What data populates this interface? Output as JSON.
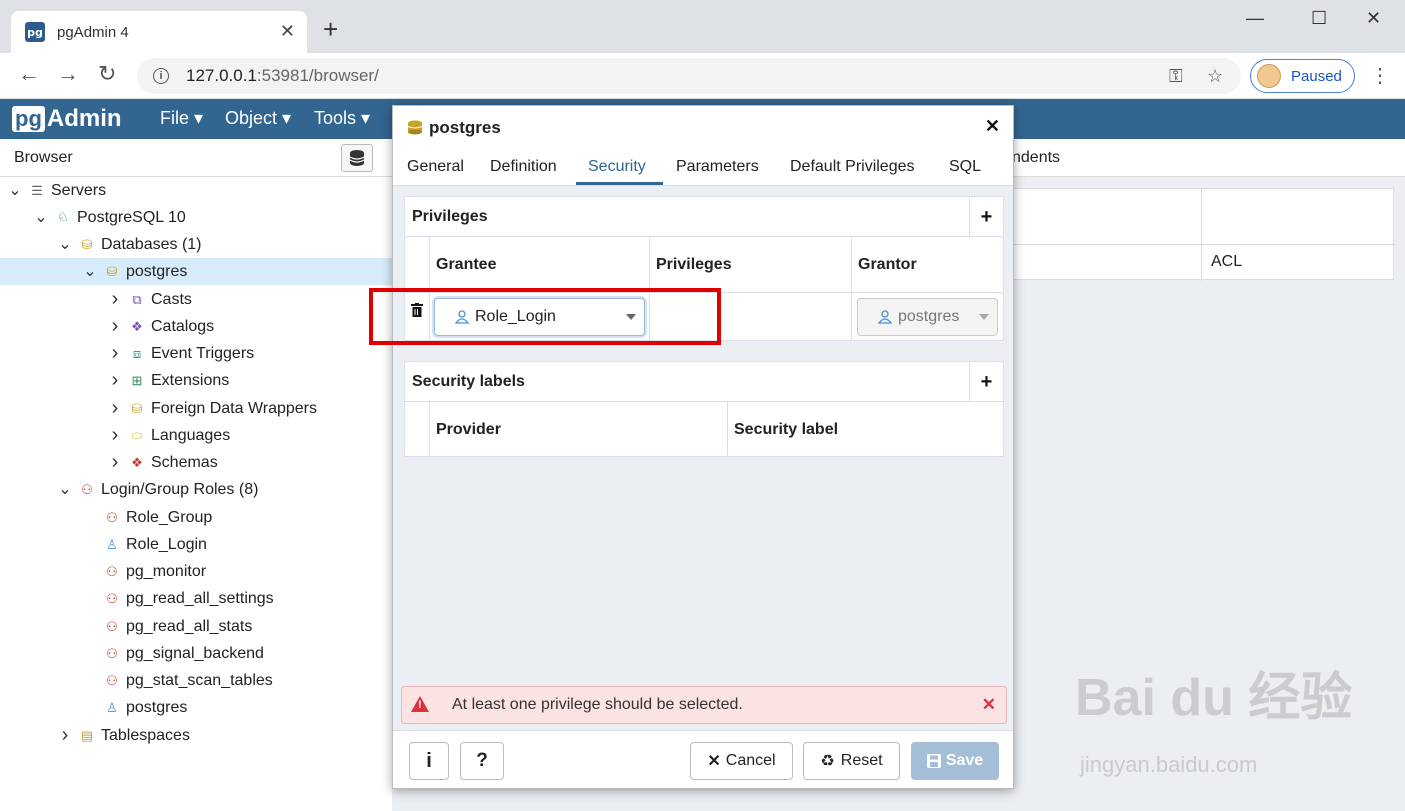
{
  "browser": {
    "tab_title": "pgAdmin 4",
    "favicon_text": "pg",
    "new_tab": "+",
    "url_host": "127.0.0.1",
    "url_rest": ":53981/browser/",
    "profile_label": "Paused"
  },
  "app": {
    "logo_pg": "pg",
    "logo_rest": "Admin",
    "menus": [
      "File ▾",
      "Object ▾",
      "Tools ▾"
    ]
  },
  "browser_panel": {
    "title": "Browser",
    "tree": [
      {
        "label": "Servers",
        "icon": "servers-icon",
        "color": "#666666"
      },
      {
        "label": "PostgreSQL 10",
        "icon": "postgresql-icon",
        "color": "#336791"
      },
      {
        "label": "Databases (1)",
        "icon": "databases-icon",
        "color": "#c9a227"
      },
      {
        "label": "postgres",
        "icon": "database-icon",
        "color": "#c9a227"
      },
      {
        "label": "Casts",
        "icon": "casts-icon",
        "color": "#7a4fb8"
      },
      {
        "label": "Catalogs",
        "icon": "catalogs-icon",
        "color": "#7a4fb8"
      },
      {
        "label": "Event Triggers",
        "icon": "event-triggers-icon",
        "color": "#2aa198"
      },
      {
        "label": "Extensions",
        "icon": "extensions-icon",
        "color": "#2e8b57"
      },
      {
        "label": "Foreign Data Wrappers",
        "icon": "fdw-icon",
        "color": "#c9a227"
      },
      {
        "label": "Languages",
        "icon": "languages-icon",
        "color": "#d4c21a"
      },
      {
        "label": "Schemas",
        "icon": "schemas-icon",
        "color": "#c0392b"
      },
      {
        "label": "Login/Group Roles (8)",
        "icon": "roles-icon",
        "color": "#c0392b"
      },
      {
        "label": "Role_Group",
        "icon": "group-role-icon",
        "color": "#c0392b"
      },
      {
        "label": "Role_Login",
        "icon": "login-role-icon",
        "color": "#4a90d9"
      },
      {
        "label": "pg_monitor",
        "icon": "group-role-icon",
        "color": "#c0392b"
      },
      {
        "label": "pg_read_all_settings",
        "icon": "group-role-icon",
        "color": "#c0392b"
      },
      {
        "label": "pg_read_all_stats",
        "icon": "group-role-icon",
        "color": "#c0392b"
      },
      {
        "label": "pg_signal_backend",
        "icon": "group-role-icon",
        "color": "#c0392b"
      },
      {
        "label": "pg_stat_scan_tables",
        "icon": "group-role-icon",
        "color": "#c0392b"
      },
      {
        "label": "postgres",
        "icon": "login-role-icon",
        "color": "#4a90d9"
      },
      {
        "label": "Tablespaces",
        "icon": "tablespaces-icon",
        "color": "#c9a227"
      }
    ]
  },
  "background": {
    "tab_label": "ndents",
    "acl_label": "ACL"
  },
  "dialog": {
    "title": "postgres",
    "tabs": [
      "General",
      "Definition",
      "Security",
      "Parameters",
      "Default Privileges",
      "SQL"
    ],
    "active_tab": "Security",
    "privileges": {
      "title": "Privileges",
      "columns": [
        "Grantee",
        "Privileges",
        "Grantor"
      ],
      "row": {
        "grantee": "Role_Login",
        "privileges": "",
        "grantor": "postgres"
      }
    },
    "security_labels": {
      "title": "Security labels",
      "columns": [
        "Provider",
        "Security label"
      ]
    },
    "error": "At least one privilege should be selected.",
    "buttons": {
      "info": "i",
      "help": "?",
      "cancel": "Cancel",
      "reset": "Reset",
      "save": "Save"
    }
  },
  "watermark": {
    "main": "Bai du 经验",
    "sub": "jingyan.baidu.com"
  }
}
